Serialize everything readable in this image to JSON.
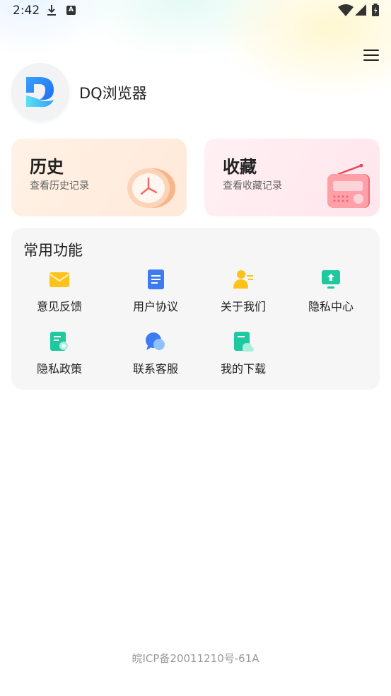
{
  "status_bar": {
    "time": "2:42",
    "icons": [
      "download-icon",
      "a-notification-icon",
      "wifi-icon",
      "signal-icon",
      "battery-icon"
    ]
  },
  "header": {
    "app_name": "DQ浏览器",
    "logo_icon": "dq-logo-icon",
    "menu_icon": "hamburger-menu-icon"
  },
  "cards": {
    "history": {
      "title": "历史",
      "subtitle": "查看历史记录",
      "icon": "clock-icon"
    },
    "favorites": {
      "title": "收藏",
      "subtitle": "查看收藏记录",
      "icon": "radio-icon"
    }
  },
  "functions": {
    "title": "常用功能",
    "items": [
      {
        "label": "意见反馈",
        "icon": "envelope-icon",
        "color": "#FFC21A"
      },
      {
        "label": "用户协议",
        "icon": "document-icon",
        "color": "#3D7BF2"
      },
      {
        "label": "关于我们",
        "icon": "person-icon",
        "color": "#FFC21A"
      },
      {
        "label": "隐私中心",
        "icon": "monitor-upload-icon",
        "color": "#1EC9A0"
      },
      {
        "label": "隐私政策",
        "icon": "policy-search-icon",
        "color": "#1EC9A0"
      },
      {
        "label": "联系客服",
        "icon": "chat-bubble-icon",
        "color": "#3D7BF2"
      },
      {
        "label": "我的下载",
        "icon": "download-file-icon",
        "color": "#1EC9A0"
      }
    ]
  },
  "footer": {
    "text": "皖ICP备20011210号-61A"
  },
  "colors": {
    "history_bg": "#FFEBDD",
    "favorites_bg": "#FFE8EE",
    "panel_bg": "#F6F6F7"
  }
}
